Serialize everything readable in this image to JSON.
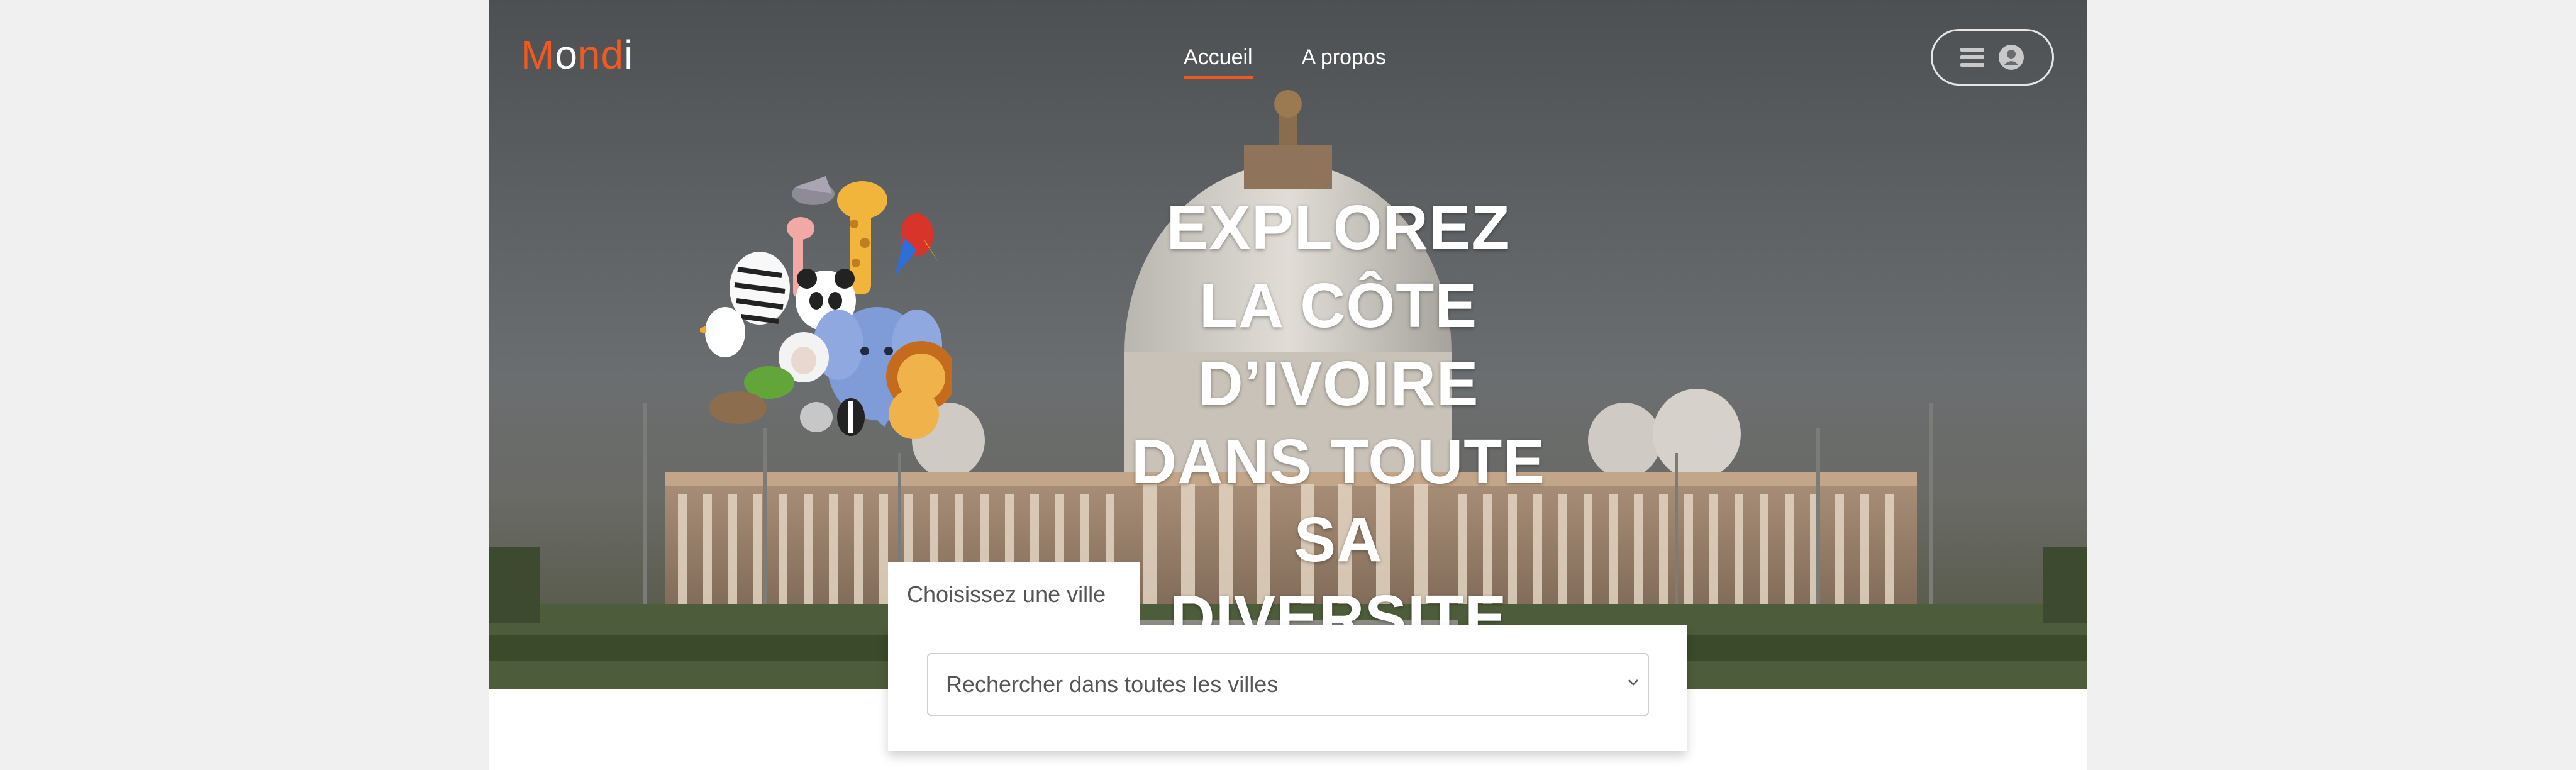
{
  "brand": {
    "parts": [
      "M",
      "o",
      "n",
      "d",
      "i"
    ]
  },
  "nav": {
    "items": [
      {
        "label": "Accueil",
        "active": true
      },
      {
        "label": "A propos",
        "active": false
      }
    ]
  },
  "header": {
    "menu_icon": "hamburger-icon",
    "user_icon": "user-circle-icon"
  },
  "hero": {
    "headline_lines": [
      "EXPLOREZ LA CÔTE",
      "D’IVOIRE DANS TOUTE",
      "SA DIVERSITE"
    ],
    "illustration": "cartoon-animals-group"
  },
  "search": {
    "tab_label": "Choisissez une ville",
    "select_value": "Rechercher dans toutes les villes"
  },
  "colors": {
    "accent": "#f05a22",
    "text_muted": "#555555"
  }
}
